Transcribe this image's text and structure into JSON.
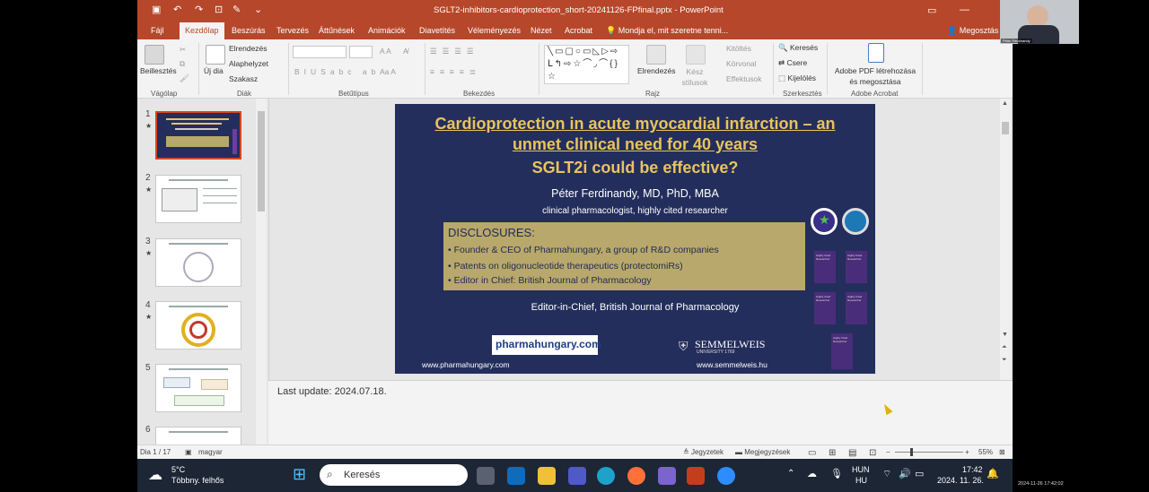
{
  "window": {
    "title": "SGLT2-inhibitors-cardioprotection_short-20241126-FPfinal.pptx  -  PowerPoint"
  },
  "menu": {
    "items": [
      "Fájl",
      "Kezdőlap",
      "Beszúrás",
      "Tervezés",
      "Áttűnések",
      "Animációk",
      "Diavetítés",
      "Véleményezés",
      "Nézet",
      "Acrobat"
    ],
    "active": "Kezdőlap",
    "tell_me": "Mondja el, mit szeretne tenni...",
    "share": "Megosztás"
  },
  "ribbon": {
    "clipboard": {
      "paste": "Beillesztés",
      "label": "Vágólap"
    },
    "slides": {
      "new_slide": "Új dia",
      "layout": "Elrendezés",
      "reset": "Alaphelyzet",
      "section": "Szakasz",
      "label": "Diák"
    },
    "font": {
      "label": "Betűtípus"
    },
    "paragraph": {
      "label": "Bekezdés"
    },
    "drawing": {
      "arrange": "Elrendezés",
      "quick_styles": "Kész stílusok",
      "fill": "Kitöltés",
      "outline": "Körvonal",
      "effects": "Effektusok",
      "label": "Rajz"
    },
    "editing": {
      "find": "Keresés",
      "replace": "Csere",
      "select": "Kijelölés",
      "label": "Szerkesztés"
    },
    "acrobat": {
      "create": "Adobe PDF létrehozása és megosztása",
      "label": "Adobe Acrobat"
    }
  },
  "thumbnails": [
    {
      "num": "1",
      "star": "★"
    },
    {
      "num": "2",
      "star": "★"
    },
    {
      "num": "3",
      "star": "★"
    },
    {
      "num": "4",
      "star": "★"
    },
    {
      "num": "5",
      "star": ""
    },
    {
      "num": "6",
      "star": ""
    }
  ],
  "slide": {
    "title_line1": "Cardioprotection in acute myocardial infarction – an",
    "title_line2": "unmet clinical need for 40 years",
    "title_line3": "SGLT2i could be effective?",
    "author": "Péter Ferdinandy, MD, PhD, MBA",
    "role": "clinical pharmacologist, highly cited researcher",
    "disclosures_heading": "DISCLOSURES:",
    "disclosures": [
      "• Founder & CEO of Pharmahungary, a group of R&D companies",
      "• Patents on oligonucleotide therapeutics (protectomiRs)",
      "• Editor in Chief: British Journal of Pharmacology"
    ],
    "editor": "Editor-in-Chief, British Journal of Pharmacology",
    "logo_left": "pharmahungary.com",
    "logo_right": "SEMMELWEIS",
    "logo_right_sub": "UNIVERSITY 1769",
    "url_left": "www.pharmahungary.com",
    "url_right": "www.semmelweis.hu",
    "badges": [
      "Highly Cited Researcher",
      "Highly Cited Researcher",
      "Highly Cited Researcher",
      "Highly Cited Researcher",
      "Highly Cited Researcher"
    ]
  },
  "notes": {
    "text": "Last update: 2024.07.18."
  },
  "status": {
    "slide_index": "Dia 1 / 17",
    "language": "magyar",
    "notes_btn": "Jegyzetek",
    "comments_btn": "Megjegyzések",
    "zoom": "55%"
  },
  "taskbar": {
    "weather_temp": "5°C",
    "weather_desc": "Többny. felhős",
    "search_placeholder": "Keresés",
    "lang_line1": "HUN",
    "lang_line2": "HU",
    "time": "17:42",
    "date": "2024. 11. 26."
  },
  "webcam": {
    "name": "Péter Ferdinandy"
  },
  "timestamp": "2024-11-26 17:42:02",
  "colors": {
    "accent": "#b7472a",
    "slide_bg": "#242e5c",
    "title_gold": "#e8c45e",
    "disclosure_bg": "#b9a86b"
  }
}
